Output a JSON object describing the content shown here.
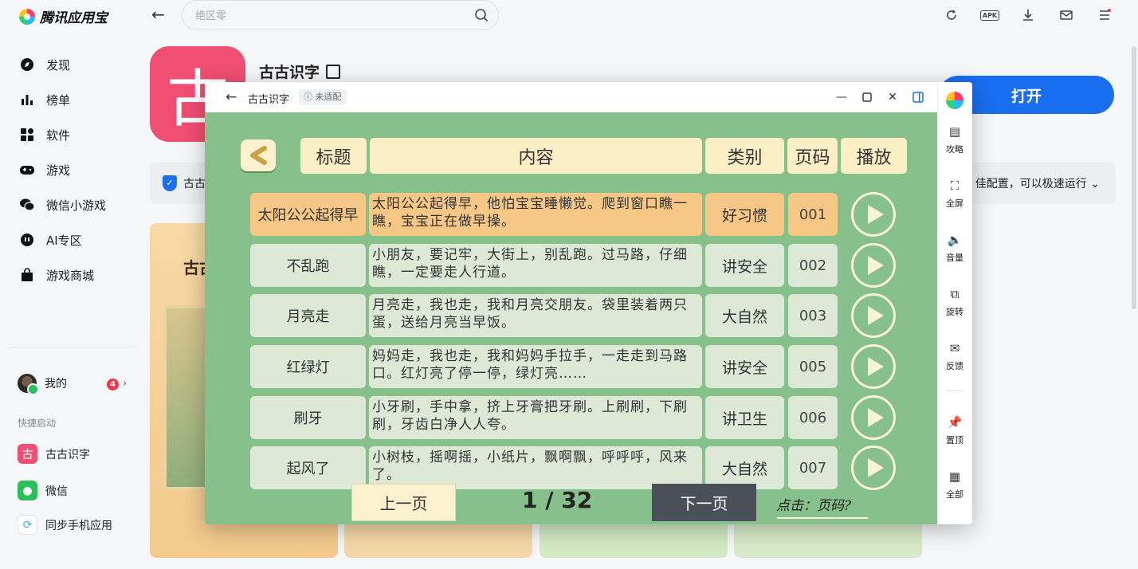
{
  "store": {
    "name": "腾讯应用宝",
    "search_placeholder": "绝区零"
  },
  "sidebar": {
    "items": [
      {
        "label": "发现",
        "icon": "compass-icon"
      },
      {
        "label": "榜单",
        "icon": "bar-chart-icon"
      },
      {
        "label": "软件",
        "icon": "apps-grid-icon"
      },
      {
        "label": "游戏",
        "icon": "gamepad-icon"
      },
      {
        "label": "微信小游戏",
        "icon": "wechat-icon"
      },
      {
        "label": "AI专区",
        "icon": "ai-icon"
      },
      {
        "label": "游戏商城",
        "icon": "shopping-bag-icon"
      }
    ],
    "me_label": "我的",
    "me_badge": "4",
    "quick_title": "快捷启动",
    "quick_items": [
      {
        "label": "古古识字",
        "color": "#f04e73"
      },
      {
        "label": "微信",
        "color": "#2bbf5c"
      },
      {
        "label": "同步手机应用",
        "color": "#ffffff"
      }
    ]
  },
  "app": {
    "name": "古古识字",
    "open_label": "打开",
    "info_left": "古古",
    "info_right": "佳配置，可以极速运行",
    "screenshot_title": "古古"
  },
  "window": {
    "title": "古古识字",
    "badge": "未适配",
    "tools": [
      "攻略",
      "全屏",
      "音量",
      "旋转",
      "反馈",
      "置顶",
      "全部"
    ]
  },
  "game": {
    "headers": {
      "title": "标题",
      "content": "内容",
      "category": "类别",
      "page": "页码",
      "play": "播放"
    },
    "rows": [
      {
        "title": "太阳公公起得早",
        "content": "太阳公公起得早，他怕宝宝睡懒觉。爬到窗口瞧一瞧，宝宝正在做早操。",
        "category": "好习惯",
        "page": "001",
        "highlighted": true
      },
      {
        "title": "不乱跑",
        "content": "小朋友，要记牢，大街上，别乱跑。过马路，仔细瞧，一定要走人行道。",
        "category": "讲安全",
        "page": "002",
        "highlighted": false
      },
      {
        "title": "月亮走",
        "content": "月亮走，我也走，我和月亮交朋友。袋里装着两只蛋，送给月亮当早饭。",
        "category": "大自然",
        "page": "003",
        "highlighted": false
      },
      {
        "title": "红绿灯",
        "content": "妈妈走，我也走，我和妈妈手拉手，一走走到马路口。红灯亮了停一停，绿灯亮……",
        "category": "讲安全",
        "page": "005",
        "highlighted": false
      },
      {
        "title": "刷牙",
        "content": "小牙刷，手中拿，挤上牙膏把牙刷。上刷刷，下刷刷，牙齿白净人人夸。",
        "category": "讲卫生",
        "page": "006",
        "highlighted": false
      },
      {
        "title": "起风了",
        "content": "小树枝，摇啊摇，小纸片，飘啊飘，呼呼呼，风来了。",
        "category": "大自然",
        "page": "007",
        "highlighted": false
      }
    ],
    "prev_label": "上一页",
    "next_label": "下一页",
    "page_indicator": "1 / 32",
    "hint": "点击：页码?"
  }
}
